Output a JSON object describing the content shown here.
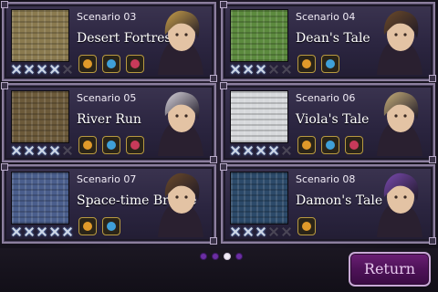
{
  "scenarios": [
    {
      "label": "Scenario 03",
      "title": "Desert Fortress",
      "swords_filled": 4,
      "swords_total": 5,
      "medals": [
        "fire-medal",
        "ice-medal",
        "magic-medal"
      ],
      "colors": {
        "map": "#8a7a4f",
        "portrait": "#c9a04a"
      }
    },
    {
      "label": "Scenario 04",
      "title": "Dean's Tale",
      "swords_filled": 3,
      "swords_total": 5,
      "medals": [
        "fire-medal",
        "ice-medal"
      ],
      "colors": {
        "map": "#5c8a3e",
        "portrait": "#6b4a2a"
      }
    },
    {
      "label": "Scenario 05",
      "title": "River Run",
      "swords_filled": 4,
      "swords_total": 5,
      "medals": [
        "fire-medal",
        "ice-medal",
        "magic-medal"
      ],
      "colors": {
        "map": "#6c5a3a",
        "portrait": "#d8d4dc"
      }
    },
    {
      "label": "Scenario 06",
      "title": "Viola's Tale",
      "swords_filled": 4,
      "swords_total": 5,
      "medals": [
        "fire-medal",
        "ice-medal",
        "magic-medal"
      ],
      "colors": {
        "map": "#d7d9dc",
        "portrait": "#c8b07a"
      }
    },
    {
      "label": "Scenario 07",
      "title": "Space-time Bridge",
      "swords_filled": 5,
      "swords_total": 5,
      "medals": [
        "fire-medal",
        "ice-medal"
      ],
      "colors": {
        "map": "#4a5e8c",
        "portrait": "#6b4a2a"
      }
    },
    {
      "label": "Scenario 08",
      "title": "Damon's Tale",
      "swords_filled": 3,
      "swords_total": 5,
      "medals": [
        "fire-medal"
      ],
      "colors": {
        "map": "#2c4a6a",
        "portrait": "#7a4ab0"
      }
    }
  ],
  "pager": {
    "total": 4,
    "active": 3
  },
  "return_label": "Return",
  "colors": {
    "accent": "#5a176a",
    "medal_fire": "#e09a2a",
    "medal_ice": "#3fa0d8",
    "medal_magic": "#c83a5a"
  }
}
